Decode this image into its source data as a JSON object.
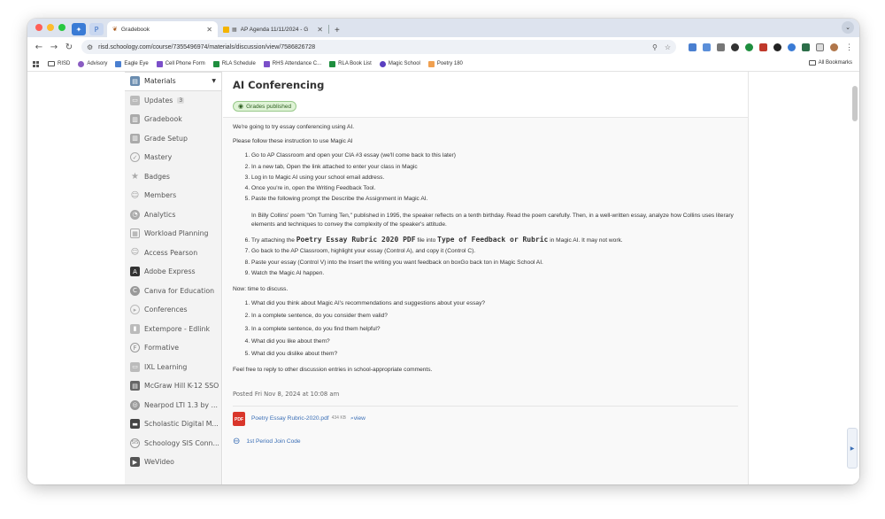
{
  "browser": {
    "tabs": [
      {
        "title": "Gradebook",
        "active": true
      },
      {
        "title": "AP Agenda 11/11/2024 - G",
        "active": false
      }
    ],
    "url": "risd.schoology.com/course/7355496974/materials/discussion/view/7586826728",
    "bookmarks": [
      "RISD",
      "Advisory",
      "Eagle Eye",
      "Cell Phone Form",
      "RLA Schedule",
      "RHS Attendance C...",
      "RLA Book List",
      "Magic School",
      "Poetry 180"
    ],
    "all_bookmarks": "All Bookmarks"
  },
  "sidebar": {
    "items": [
      {
        "label": "Materials",
        "icon": "materials-icon"
      },
      {
        "label": "Updates",
        "icon": "updates-icon",
        "badge": "3"
      },
      {
        "label": "Gradebook",
        "icon": "gradebook-icon"
      },
      {
        "label": "Grade Setup",
        "icon": "grade-setup-icon"
      },
      {
        "label": "Mastery",
        "icon": "mastery-icon"
      },
      {
        "label": "Badges",
        "icon": "badges-icon"
      },
      {
        "label": "Members",
        "icon": "members-icon"
      },
      {
        "label": "Analytics",
        "icon": "analytics-icon"
      },
      {
        "label": "Workload Planning",
        "icon": "workload-icon"
      },
      {
        "label": "Access Pearson",
        "icon": "pearson-icon"
      },
      {
        "label": "Adobe Express",
        "icon": "adobe-icon"
      },
      {
        "label": "Canva for Education",
        "icon": "canva-icon"
      },
      {
        "label": "Conferences",
        "icon": "conferences-icon"
      },
      {
        "label": "Extempore - Edlink",
        "icon": "extempore-icon"
      },
      {
        "label": "Formative",
        "icon": "formative-icon"
      },
      {
        "label": "IXL Learning",
        "icon": "ixl-icon"
      },
      {
        "label": "McGraw Hill K-12 SSO",
        "icon": "mcgraw-icon"
      },
      {
        "label": "Nearpod LTI 1.3 by ...",
        "icon": "nearpod-icon"
      },
      {
        "label": "Scholastic Digital M...",
        "icon": "scholastic-icon"
      },
      {
        "label": "Schoology SIS Conn...",
        "icon": "sis-icon"
      },
      {
        "label": "WeVideo",
        "icon": "wevideo-icon"
      }
    ]
  },
  "main": {
    "title": "AI Conferencing",
    "status": "Grades published",
    "intro1": "We're going to try essay conferencing using AI.",
    "intro2": "Please follow these instruction to use Magic AI",
    "steps_a": [
      "Go to AP Classroom and open your CIA #3 essay (we'll come back to this later)",
      "In a new tab, Open the link attached to enter your class in Magic",
      "Log in to Magic AI using your school email address.",
      "Once you're in, open the Writing Feedback Tool.",
      "Paste the following prompt the Describe the Assignment in Magic AI."
    ],
    "prompt": "In Billy Collins' poem \"On Turning Ten,\" published in 1995, the speaker reflects on a tenth birthday.  Read the poem carefully.  Then, in a well-written essay, analyze how Collins uses literary elements and techniques to convey the complexity of the speaker's attitude.",
    "step6": {
      "pre": "Try attaching the ",
      "b1": "Poetry Essay Rubric 2020 PDF",
      "mid": " file into ",
      "b2": "Type of Feedback or Rubric",
      "post": " in Magic AI. It may not work."
    },
    "steps_b": [
      "Go back to the AP Classroom, highlight your essay (Control A), and copy it (Control C).",
      "Paste your essay (Control V) into the Insert the writing you want feedback on boxGo back ton in Magic School AI.",
      "Watch the Magic AI happen."
    ],
    "discuss_heading": "Now: time to discuss.",
    "questions": [
      "What did you think about Magic AI's recommendations and suggestions about your essay?",
      "In a complete sentence, do you consider them valid?",
      "In a complete sentence, do you find them helpful?",
      "What did you like about them?",
      "What did you dislike about them?"
    ],
    "closing": "Feel free to reply to other discussion entries in school-appropriate comments.",
    "posted": "Posted Fri Nov 8, 2024 at 10:08 am",
    "attachment": {
      "name": "Poetry Essay Rubric-2020.pdf",
      "size": "434 KB",
      "view": "view"
    },
    "link": "1st Period Join Code"
  }
}
